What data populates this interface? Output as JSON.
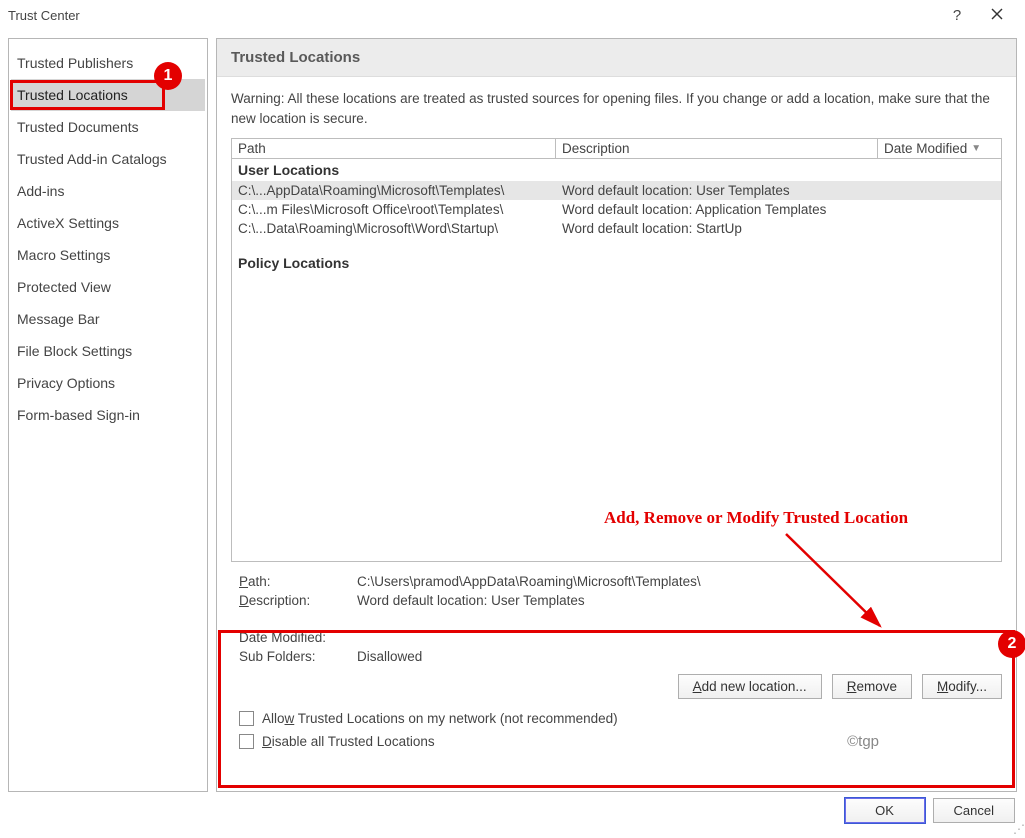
{
  "title": "Trust Center",
  "sidebar": {
    "items": [
      {
        "label": "Trusted Publishers"
      },
      {
        "label": "Trusted Locations",
        "selected": true
      },
      {
        "label": "Trusted Documents"
      },
      {
        "label": "Trusted Add-in Catalogs"
      },
      {
        "label": "Add-ins"
      },
      {
        "label": "ActiveX Settings"
      },
      {
        "label": "Macro Settings"
      },
      {
        "label": "Protected View"
      },
      {
        "label": "Message Bar"
      },
      {
        "label": "File Block Settings"
      },
      {
        "label": "Privacy Options"
      },
      {
        "label": "Form-based Sign-in"
      }
    ]
  },
  "main": {
    "section_title": "Trusted Locations",
    "warning": "Warning: All these locations are treated as trusted sources for opening files.  If you change or add a location, make sure that the new location is secure.",
    "columns": {
      "path": "Path",
      "description": "Description",
      "date": "Date Modified"
    },
    "groups": [
      {
        "name": "User Locations",
        "rows": [
          {
            "path": "C:\\...AppData\\Roaming\\Microsoft\\Templates\\",
            "desc": "Word default location: User Templates",
            "selected": true
          },
          {
            "path": "C:\\...m Files\\Microsoft Office\\root\\Templates\\",
            "desc": "Word default location: Application Templates"
          },
          {
            "path": "C:\\...Data\\Roaming\\Microsoft\\Word\\Startup\\",
            "desc": "Word default location: StartUp"
          }
        ]
      },
      {
        "name": "Policy Locations",
        "rows": []
      }
    ],
    "details": {
      "path_label": "Path:",
      "path_value": "C:\\Users\\pramod\\AppData\\Roaming\\Microsoft\\Templates\\",
      "desc_label": "Description:",
      "desc_value": "Word default location: User Templates",
      "date_label": "Date Modified:",
      "date_value": "",
      "sub_label": "Sub Folders:",
      "sub_value": "Disallowed"
    },
    "buttons": {
      "add": "Add new location...",
      "remove": "Remove",
      "modify": "Modify..."
    },
    "checks": {
      "allow_network": "Allow Trusted Locations on my network (not recommended)",
      "disable_all": "Disable all Trusted Locations"
    }
  },
  "footer": {
    "ok": "OK",
    "cancel": "Cancel"
  },
  "annotations": {
    "badge1": "1",
    "badge2": "2",
    "text": "Add, Remove or Modify Trusted Location"
  },
  "watermark": "©tgp"
}
